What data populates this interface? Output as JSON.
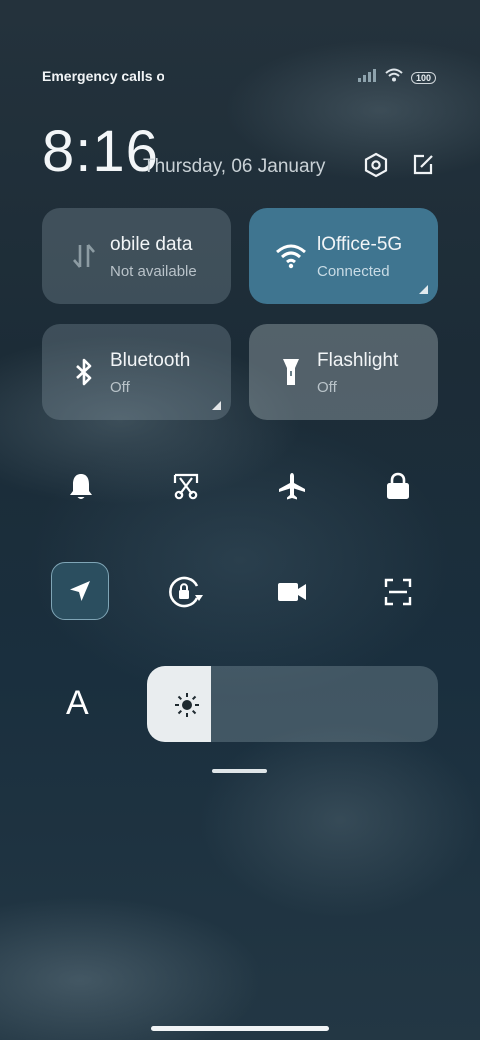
{
  "status_bar": {
    "carrier_text": "Emergency calls o",
    "battery": "100"
  },
  "header": {
    "time": "8:16",
    "date": "Thursday, 06 January"
  },
  "tiles": [
    {
      "id": "mobile-data",
      "name": "obile data",
      "status": "Not available",
      "active": false
    },
    {
      "id": "wifi",
      "name": "lOffice-5G",
      "status": "Connected",
      "active": true
    },
    {
      "id": "bluetooth",
      "name": "Bluetooth",
      "status": "Off",
      "active": false
    },
    {
      "id": "flashlight",
      "name": "Flashlight",
      "status": "Off",
      "active": false
    }
  ],
  "toggles_row1": [
    "bell-icon",
    "screenshot-icon",
    "airplane-icon",
    "lock-icon"
  ],
  "toggles_row2": [
    "location-icon",
    "rotation-lock-icon",
    "video-icon",
    "scan-icon"
  ],
  "brightness": {
    "auto_label": "A",
    "level": 0.22
  },
  "colors": {
    "wifi_tile": "#3f7590",
    "inactive_tile": "rgba(150,170,180,0.28)",
    "flashlight_tile": "rgba(200,210,215,0.32)"
  }
}
